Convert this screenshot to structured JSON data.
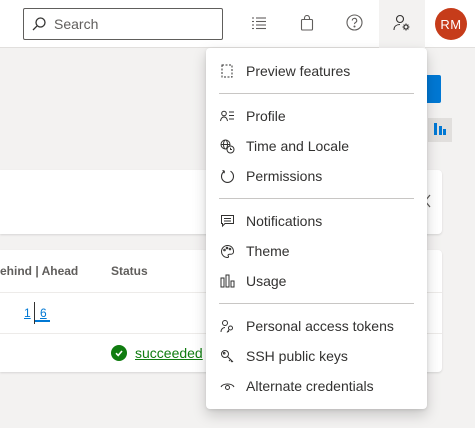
{
  "search": {
    "placeholder": "Search"
  },
  "user": {
    "initials": "RM"
  },
  "table": {
    "headers": {
      "behind_ahead": "ehind | Ahead",
      "status": "Status"
    },
    "row1": {
      "behind": "1",
      "ahead": "6"
    },
    "row2": {
      "status": "succeeded"
    }
  },
  "menu": {
    "items": [
      {
        "label": "Preview features",
        "icon": "preview-icon"
      },
      {
        "label": "Profile",
        "icon": "profile-icon"
      },
      {
        "label": "Time and Locale",
        "icon": "globe-clock-icon"
      },
      {
        "label": "Permissions",
        "icon": "permissions-icon"
      },
      {
        "label": "Notifications",
        "icon": "notifications-icon"
      },
      {
        "label": "Theme",
        "icon": "palette-icon"
      },
      {
        "label": "Usage",
        "icon": "usage-icon"
      },
      {
        "label": "Personal access tokens",
        "icon": "key-person-icon"
      },
      {
        "label": "SSH public keys",
        "icon": "ssh-key-icon"
      },
      {
        "label": "Alternate credentials",
        "icon": "eye-icon"
      }
    ]
  },
  "colors": {
    "accent": "#0078d4",
    "avatar": "#c63c1a",
    "success": "#107c10"
  }
}
